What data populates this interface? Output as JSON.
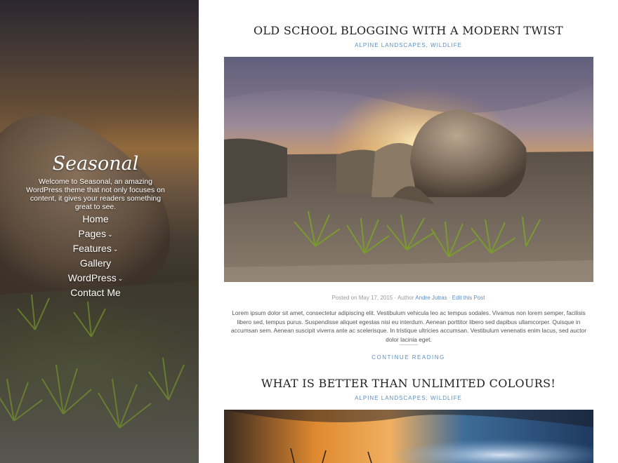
{
  "site": {
    "title": "Seasonal",
    "description": "Welcome to Seasonal, an amazing WordPress theme that not only focuses on content, it gives your readers something great to see."
  },
  "menu": [
    {
      "label": "Home",
      "has_submenu": false
    },
    {
      "label": "Pages",
      "has_submenu": true
    },
    {
      "label": "Features",
      "has_submenu": true
    },
    {
      "label": "Gallery",
      "has_submenu": false
    },
    {
      "label": "WordPress",
      "has_submenu": true
    },
    {
      "label": "Contact Me",
      "has_submenu": false
    }
  ],
  "posts": [
    {
      "title": "OLD SCHOOL BLOGGING WITH A MODERN TWIST",
      "categories": [
        "ALPINE LANDSCAPES",
        "WILDLIFE"
      ],
      "meta": {
        "posted_prefix": "Posted on",
        "date": "May 17, 2015",
        "author_prefix": "Author",
        "author": "Andre Jutras",
        "edit_link": "Edit this Post"
      },
      "excerpt": "Lorem ipsum dolor sit amet, consectetur adipiscing elit. Vestibulum vehicula leo ac tempus sodales. Vivamus non lorem semper, facilisis libero sed, tempus purus. Suspendisse aliquet egestas nisi eu interdum. Aenean porttitor libero sed dapibus ullamcorper. Quisque in accumsan sem. Aenean suscipit viverra ante ac scelerisque. In tristique ultricies accumsan. Vestibulum venenatis enim lacus, sed auctor dolor lacinia eget.",
      "read_more": "CONTINUE READING"
    },
    {
      "title": "WHAT IS BETTER THAN UNLIMITED COLOURS!",
      "categories": [
        "ALPINE LANDSCAPES",
        "WILDLIFE"
      ]
    }
  ],
  "separators": {
    "category": ", ",
    "meta": "·"
  },
  "icons": {
    "submenu": "chevron-down-icon"
  },
  "colors": {
    "accent": "#5a8fc4",
    "title": "#222222",
    "text": "#555555"
  }
}
